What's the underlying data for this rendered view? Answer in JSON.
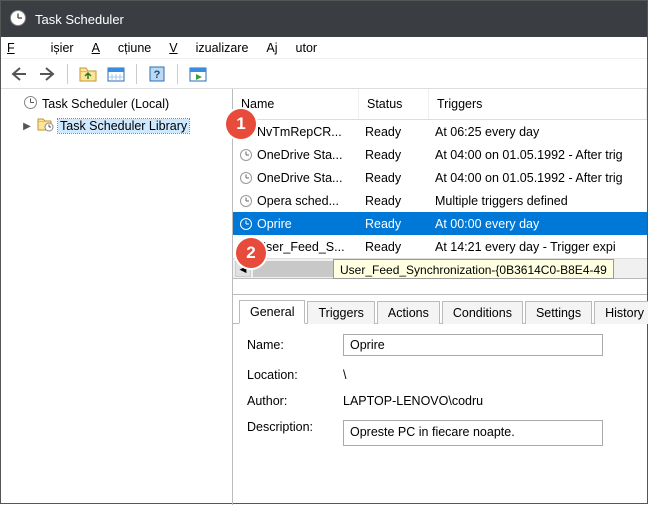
{
  "titlebar": {
    "title": "Task Scheduler"
  },
  "menu": {
    "file": "Fișier",
    "action": "Acțiune",
    "view": "Vizualizare",
    "help": "Ajutor"
  },
  "tree": {
    "root": "Task Scheduler (Local)",
    "library": "Task Scheduler Library"
  },
  "columns": {
    "name": "Name",
    "status": "Status",
    "triggers": "Triggers"
  },
  "tasks": [
    {
      "name": "NvTmRepCR...",
      "status": "Ready",
      "trigger": "At 06:25 every day"
    },
    {
      "name": "OneDrive Sta...",
      "status": "Ready",
      "trigger": "At 04:00 on 01.05.1992 - After trig"
    },
    {
      "name": "OneDrive Sta...",
      "status": "Ready",
      "trigger": "At 04:00 on 01.05.1992 - After trig"
    },
    {
      "name": "Opera sched...",
      "status": "Ready",
      "trigger": "Multiple triggers defined"
    },
    {
      "name": "Oprire",
      "status": "Ready",
      "trigger": "At 00:00 every day"
    },
    {
      "name": "User_Feed_S...",
      "status": "Ready",
      "trigger": "At 14:21 every day - Trigger expi"
    }
  ],
  "tooltip": "User_Feed_Synchronization-{0B3614C0-B8E4-49",
  "detailTabs": {
    "general": "General",
    "triggers": "Triggers",
    "actions": "Actions",
    "conditions": "Conditions",
    "settings": "Settings",
    "history": "History"
  },
  "detail": {
    "name_label": "Name:",
    "name_value": "Oprire",
    "location_label": "Location:",
    "location_value": "\\",
    "author_label": "Author:",
    "author_value": "LAPTOP-LENOVO\\codru",
    "description_label": "Description:",
    "description_value": "Opreste PC in fiecare noapte."
  },
  "callouts": {
    "one": "1",
    "two": "2"
  }
}
